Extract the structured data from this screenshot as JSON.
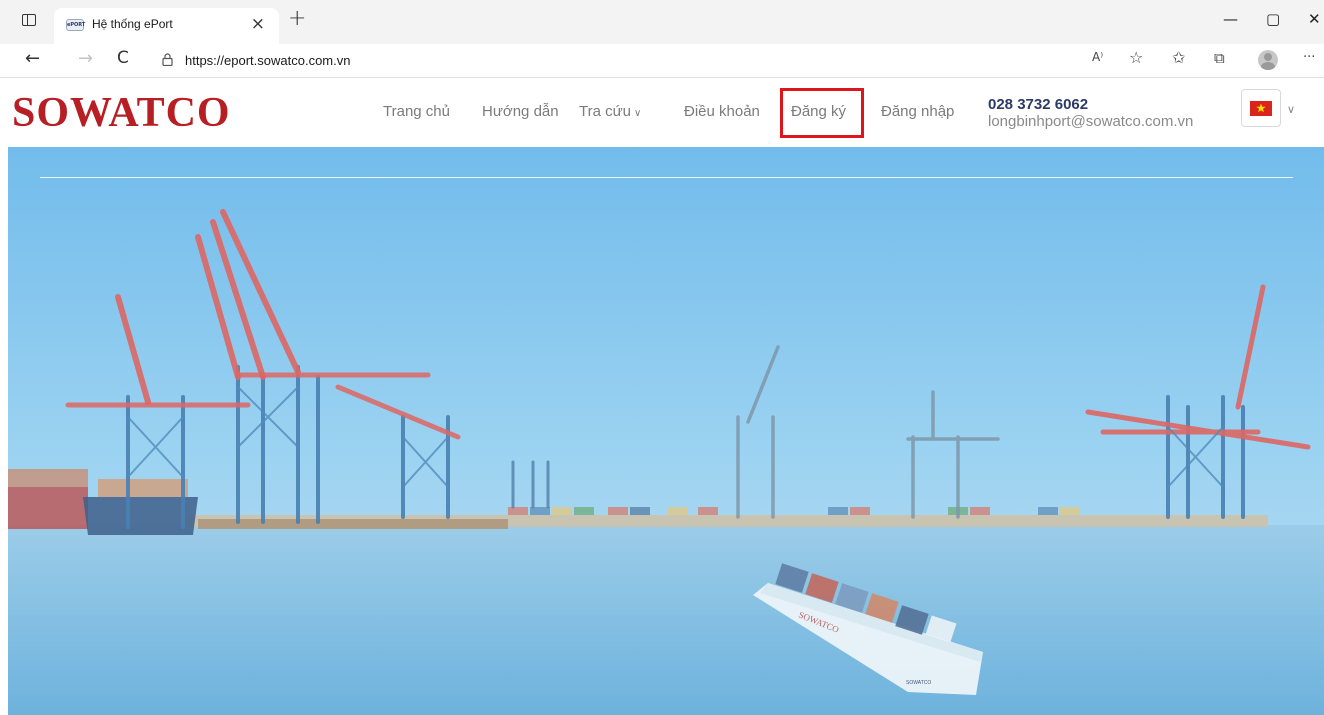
{
  "browser": {
    "tab_title": "Hệ thống ePort",
    "tab_favicon_text": "ePORT",
    "url": "https://eport.sowatco.com.vn",
    "tab_close_glyph": "×",
    "new_tab_glyph": "+",
    "window_controls": {
      "minimize": "—",
      "restore": "▢",
      "close": "✕"
    },
    "nav": {
      "back": "←",
      "forward": "→",
      "reload": "C"
    },
    "toolbar_icons": [
      "read-aloud-icon",
      "add-favorite-icon",
      "favorites-icon",
      "collections-icon",
      "profile-icon",
      "more-icon"
    ],
    "toolbar_glyphs": {
      "read_aloud": "A⁾",
      "add_favorite": "☆",
      "favorites": "✩",
      "collections": "⧉",
      "more": "···"
    }
  },
  "site": {
    "logo": "SOWATCO",
    "menu": [
      {
        "label": "Trang chủ"
      },
      {
        "label": "Hướng dẫn"
      },
      {
        "label": "Tra cứu",
        "has_dropdown": true
      },
      {
        "label": "Điều khoản"
      },
      {
        "label": "Đăng ký",
        "highlighted": true
      },
      {
        "label": "Đăng nhập"
      }
    ],
    "dropdown_caret": "∨",
    "contact": {
      "phone": "028 3732 6062",
      "email": "longbinhport@sowatco.com.vn"
    },
    "language": {
      "flag": "vietnam-flag-icon",
      "caret": "∨"
    }
  },
  "hero": {
    "ship_hull_text": "SOWATCO",
    "ship_stern_text": "SOWATCO"
  },
  "colors": {
    "brand_red": "#b81f24",
    "highlight_red": "#e0151b",
    "menu_gray": "#7b7b7b",
    "phone_navy": "#2c3a66",
    "hero_sky": "#7cc3ec",
    "hero_sea": "#6fb4dd"
  }
}
